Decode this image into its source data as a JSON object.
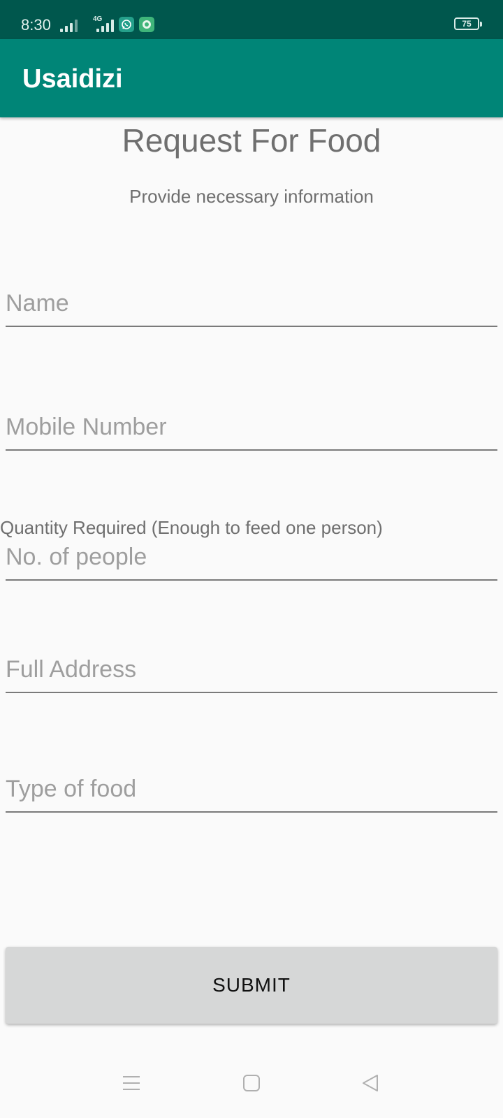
{
  "status_bar": {
    "time": "8:30",
    "network_type": "4G",
    "battery": "75",
    "icons": [
      "signal-icon",
      "signal-4g-icon",
      "whatsapp-icon",
      "app-notification-icon"
    ]
  },
  "app_bar": {
    "title": "Usaidizi",
    "color": "#008577"
  },
  "form": {
    "title": "Request For Food",
    "subtitle": "Provide necessary information",
    "fields": {
      "name": {
        "placeholder": "Name",
        "value": ""
      },
      "mobile": {
        "placeholder": "Mobile Number",
        "value": ""
      },
      "quantity_label": "Quantity Required (Enough to feed one person)",
      "people": {
        "placeholder": "No. of people",
        "value": ""
      },
      "address": {
        "placeholder": "Full Address",
        "value": ""
      },
      "food_type": {
        "placeholder": "Type of food",
        "value": ""
      }
    },
    "submit_label": "SUBMIT"
  },
  "nav_bar": {
    "icons": [
      "menu-icon",
      "home-icon",
      "back-icon"
    ]
  }
}
